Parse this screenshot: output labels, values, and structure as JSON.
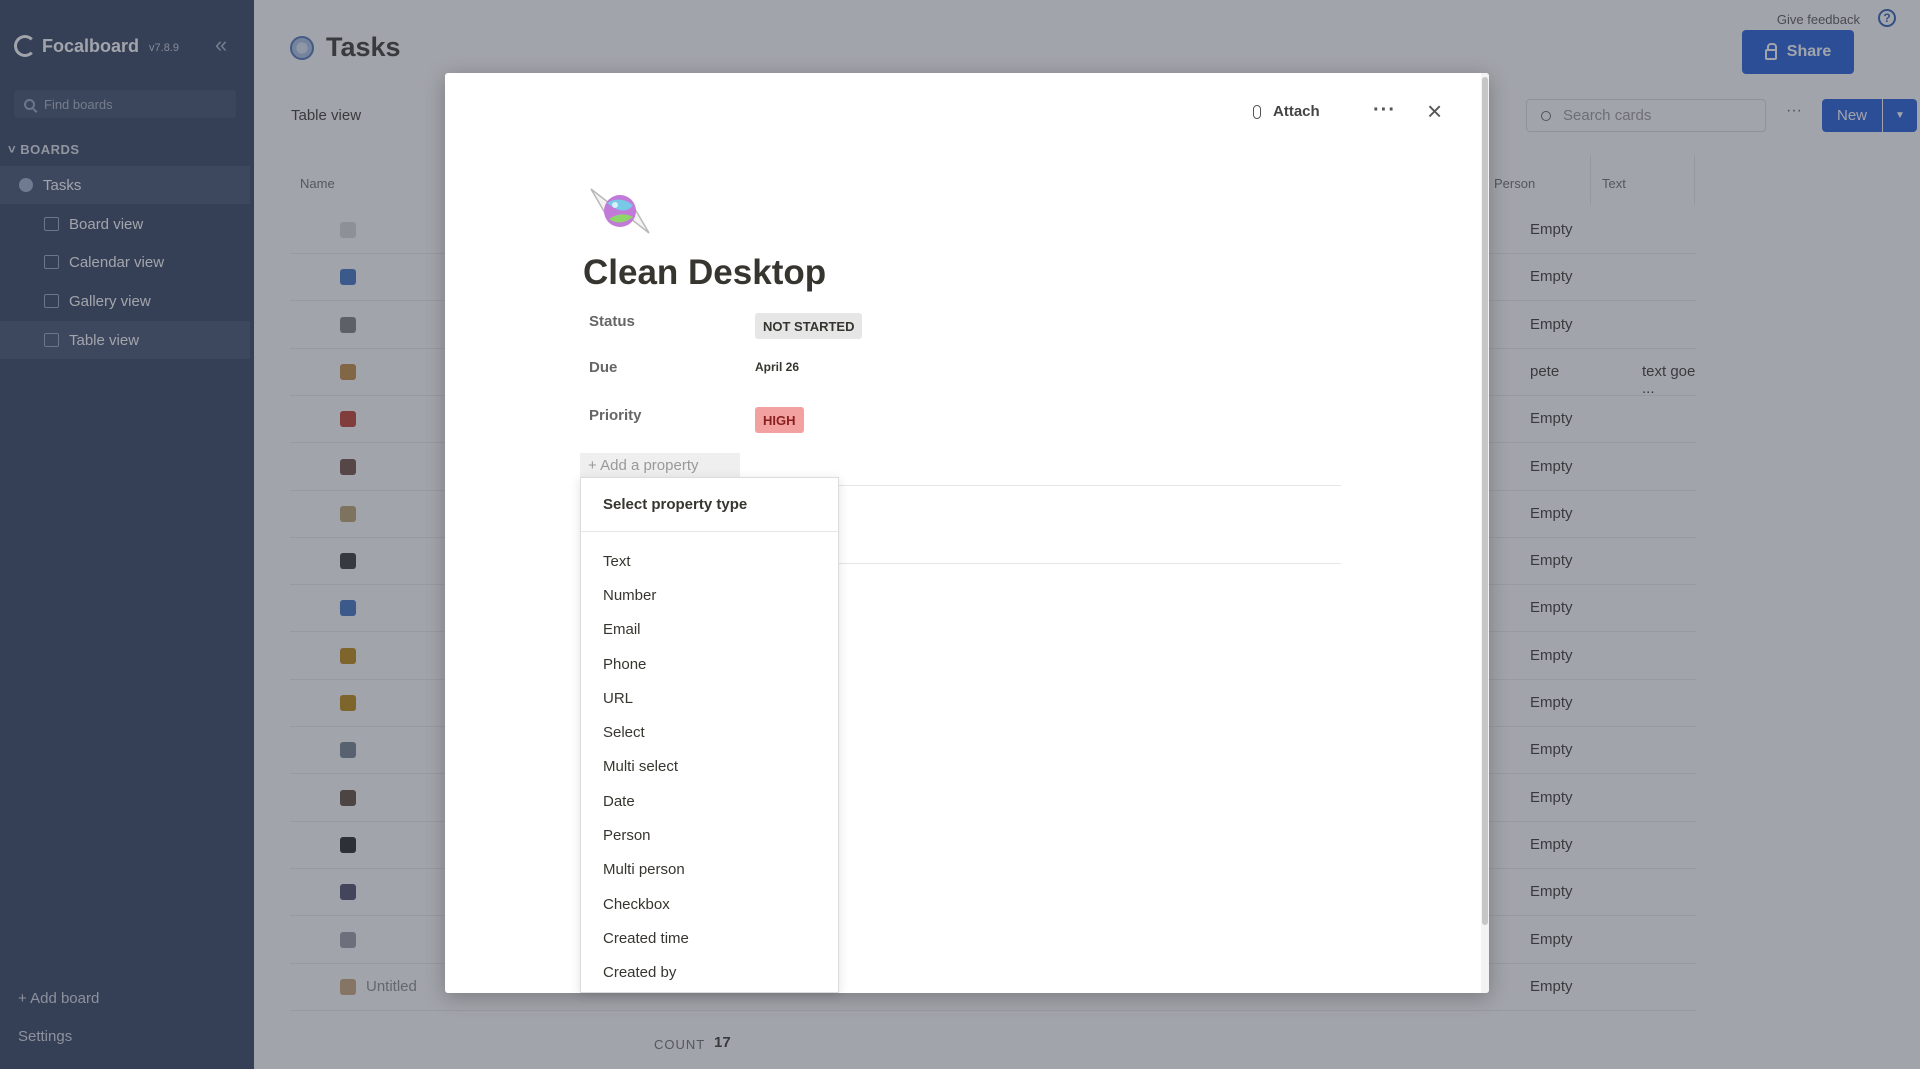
{
  "sidebar": {
    "brand": "Focalboard",
    "version": "v7.8.9",
    "search_placeholder": "Find boards",
    "section": "BOARDS",
    "board": "Tasks",
    "views": [
      "Board view",
      "Calendar view",
      "Gallery view",
      "Table view"
    ],
    "add_board": "+ Add board",
    "settings": "Settings"
  },
  "header": {
    "feedback": "Give feedback",
    "title": "Tasks",
    "share": "Share"
  },
  "toolbar": {
    "view_name": "Table view",
    "search_placeholder": "Search cards",
    "more": "···",
    "new": "New"
  },
  "table": {
    "columns": {
      "name": "Name",
      "person": "Person",
      "text": "Text"
    },
    "rows": [
      {
        "person": "Empty",
        "text": ""
      },
      {
        "person": "Empty",
        "text": ""
      },
      {
        "person": "Empty",
        "text": ""
      },
      {
        "person": "pete",
        "text": "text goe ..."
      },
      {
        "person": "Empty",
        "text": ""
      },
      {
        "person": "Empty",
        "text": ""
      },
      {
        "person": "Empty",
        "text": ""
      },
      {
        "person": "Empty",
        "text": ""
      },
      {
        "person": "Empty",
        "text": ""
      },
      {
        "person": "Empty",
        "text": ""
      },
      {
        "person": "Empty",
        "text": ""
      },
      {
        "person": "Empty",
        "text": ""
      },
      {
        "person": "Empty",
        "text": ""
      },
      {
        "person": "Empty",
        "text": ""
      },
      {
        "person": "Empty",
        "text": ""
      },
      {
        "person": "Empty",
        "text": ""
      },
      {
        "name": "Untitled",
        "person": "Empty",
        "text": ""
      }
    ],
    "count_label": "COUNT",
    "count_value": "17"
  },
  "card": {
    "attach": "Attach",
    "more": "···",
    "close": "×",
    "icon": "candy-icon",
    "title": "Clean Desktop",
    "properties": [
      {
        "name": "Status",
        "value": "NOT STARTED"
      },
      {
        "name": "Due",
        "value": "April 26"
      },
      {
        "name": "Priority",
        "value": "HIGH"
      }
    ],
    "add_property": "+ Add a property"
  },
  "menu": {
    "header": "Select property type",
    "items": [
      "Text",
      "Number",
      "Email",
      "Phone",
      "URL",
      "Select",
      "Multi select",
      "Date",
      "Person",
      "Multi person",
      "Checkbox",
      "Created time",
      "Created by"
    ]
  },
  "colors": {
    "sidebar_bg": "#2e3e5c",
    "accent": "#1e5bd8",
    "priority_high": "#f2a0a0",
    "status_bg": "#e6e6e6"
  }
}
